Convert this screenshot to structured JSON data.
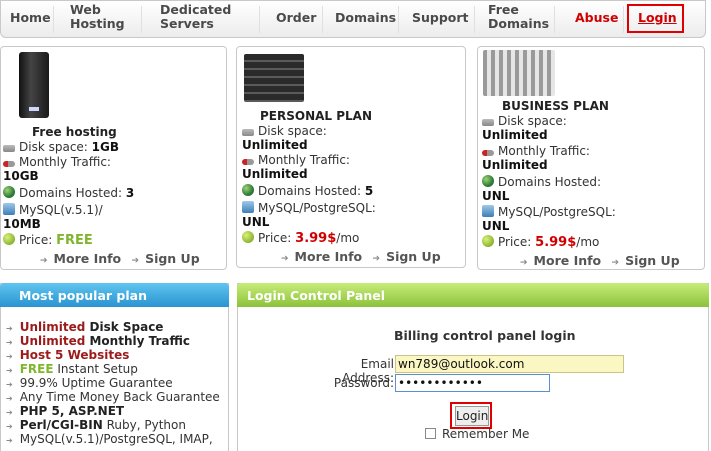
{
  "nav": {
    "home": "Home",
    "web_hosting_1": "Web",
    "web_hosting_2": "Hosting",
    "dedicated_1": "Dedicated",
    "dedicated_2": "Servers",
    "order": "Order",
    "domains": "Domains",
    "support": "Support",
    "free_domains_1": "Free",
    "free_domains_2": "Domains",
    "abuse": "Abuse",
    "login": "Login"
  },
  "plans": {
    "free": {
      "title": "Free hosting",
      "disk_label": "Disk space:",
      "disk_value": "1GB",
      "traffic_label": "Monthly Traffic:",
      "traffic_value": "10GB",
      "domains_label": "Domains Hosted:",
      "domains_value": "3",
      "mysql_label": "MySQL(v.5.1)/",
      "mysql_value": "10MB",
      "price_label": "Price:",
      "price_value": "FREE",
      "more_info": "More Info",
      "sign_up": "Sign Up"
    },
    "personal": {
      "title": "PERSONAL PLAN",
      "disk_label": "Disk space:",
      "disk_value": "Unlimited",
      "traffic_label": "Monthly Traffic:",
      "traffic_value": "Unlimited",
      "domains_label": "Domains Hosted:",
      "domains_value": "5",
      "mysql_label": "MySQL/PostgreSQL:",
      "mysql_value": "UNL",
      "price_label": "Price:",
      "price_value": "3.99$",
      "price_unit": "/mo",
      "more_info": "More Info",
      "sign_up": "Sign Up"
    },
    "business": {
      "title": "BUSINESS PLAN",
      "disk_label": "Disk space:",
      "disk_value": "Unlimited",
      "traffic_label": "Monthly Traffic:",
      "traffic_value": "Unlimited",
      "domains_label": "Domains Hosted:",
      "domains_value": "UNL",
      "mysql_label": "MySQL/PostgreSQL:",
      "mysql_value": "UNL",
      "price_label": "Price:",
      "price_value": "5.99$",
      "price_unit": "/mo",
      "more_info": "More Info",
      "sign_up": "Sign Up"
    }
  },
  "popular": {
    "header": "Most popular plan",
    "items": [
      {
        "a": "Unlimited",
        "b": " Disk Space"
      },
      {
        "a": "Unlimited",
        "b": " Monthly Traffic"
      },
      {
        "a": "Host 5 Websites",
        "b": ""
      },
      {
        "a": "FREE",
        "b": " Instant Setup"
      },
      {
        "a": "",
        "b": "99.9% Uptime Guarantee"
      },
      {
        "a": "",
        "b": "Any Time Money Back Guarantee"
      },
      {
        "a": "PHP 5, ASP.NET",
        "b": ""
      },
      {
        "a": "Perl/CGI-BIN",
        "b": " Ruby, Python"
      },
      {
        "a": "",
        "b": "MySQL(v.5.1)/PostgreSQL, IMAP,"
      }
    ]
  },
  "login_panel": {
    "header": "Login Control Panel",
    "title": "Billing control panel login",
    "email_label": "Email Address:",
    "email_value": "wn789@outlook.com",
    "password_label": "Password:",
    "password_value": "••••••••••••",
    "button": "Login",
    "remember": "Remember Me"
  },
  "colors": {
    "accent_red": "#d10000",
    "free_green": "#7fb62d",
    "popular_header_blue": "#2a93d0",
    "login_header_green": "#8bc23a"
  },
  "icons": [
    "disk-icon",
    "traffic-icon",
    "globe-icon",
    "database-icon",
    "price-icon",
    "arrow-icon",
    "checkbox"
  ]
}
